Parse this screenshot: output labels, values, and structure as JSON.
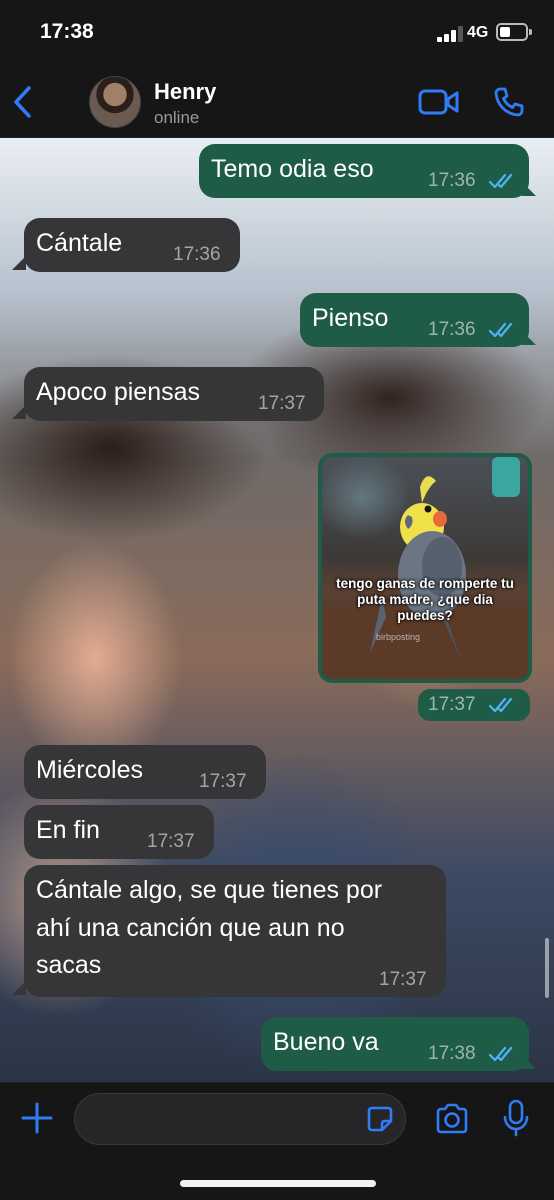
{
  "status_bar": {
    "time": "17:38",
    "network": "4G",
    "battery_level": 0.4,
    "signal_bars": 3
  },
  "header": {
    "contact_name": "Henry",
    "contact_status": "online",
    "back_icon": "chevron-left-icon",
    "video_icon": "video-camera-icon",
    "call_icon": "phone-icon",
    "accent_color": "#2f7cf6"
  },
  "messages": [
    {
      "direction": "out",
      "text": "Temo odia eso",
      "time": "17:36",
      "read": true
    },
    {
      "direction": "in",
      "text": "Cántale",
      "time": "17:36"
    },
    {
      "direction": "out",
      "text": "Pienso",
      "time": "17:36",
      "read": true
    },
    {
      "direction": "in",
      "text": "Apoco piensas",
      "time": "17:37"
    },
    {
      "direction": "out",
      "type": "image",
      "caption": "tengo ganas de romperte tu puta madre, ¿que dia puedes?",
      "watermark": "birbposting",
      "time": "17:37",
      "read": true
    },
    {
      "direction": "in",
      "text": "Miércoles",
      "time": "17:37"
    },
    {
      "direction": "in",
      "text": "En fin",
      "time": "17:37"
    },
    {
      "direction": "in",
      "lines": [
        "Cántale algo, se que tienes por",
        "ahí una canción que aun no",
        "sacas"
      ],
      "time": "17:37"
    },
    {
      "direction": "out",
      "text": "Bueno va",
      "time": "17:38",
      "read": true
    }
  ],
  "input_bar": {
    "placeholder": "",
    "plus_icon": "plus-icon",
    "sticker_icon": "sticker-icon",
    "camera_icon": "camera-icon",
    "mic_icon": "microphone-icon"
  },
  "colors": {
    "outgoing_bubble": "#1f5c47",
    "incoming_bubble": "#363638",
    "read_ticks": "#4fb3f6",
    "bar_background": "#161616"
  }
}
